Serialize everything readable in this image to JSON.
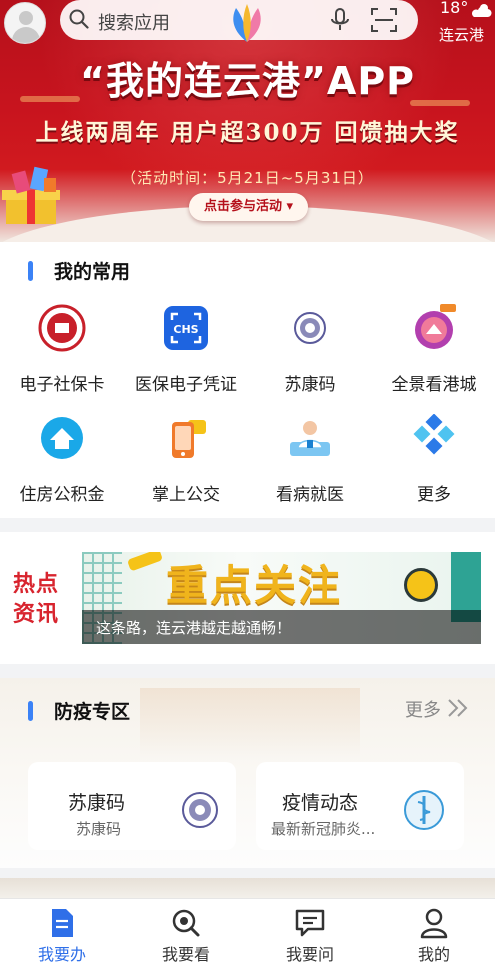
{
  "status": {
    "temperature": "18°",
    "city": "连云港",
    "weather_icon": "cloud-sun-icon"
  },
  "header": {
    "search_placeholder": "搜索应用",
    "mic_icon": "mic-icon",
    "scan_icon": "scan-icon"
  },
  "banner": {
    "title": "“我的连云港”APP",
    "subtitle": "上线两周年 用户超300万 回馈抽大奖",
    "time": "（活动时间：5月21日~5月31日）",
    "button": "点击参与活动"
  },
  "favorites": {
    "title": "我的常用",
    "items": [
      {
        "label": "电子社保卡",
        "icon": "social-security-card-icon"
      },
      {
        "label": "医保电子凭证",
        "icon": "chs-medical-insurance-icon"
      },
      {
        "label": "苏康码",
        "icon": "sukang-code-icon"
      },
      {
        "label": "全景看港城",
        "icon": "panorama-city-icon"
      },
      {
        "label": "住房公积金",
        "icon": "housing-fund-icon"
      },
      {
        "label": "掌上公交",
        "icon": "bus-icon"
      },
      {
        "label": "看病就医",
        "icon": "doctor-icon"
      },
      {
        "label": "更多",
        "icon": "more-grid-icon"
      }
    ]
  },
  "news": {
    "tag": "热点资讯",
    "headline_image_text": "重点关注",
    "caption": "这条路，连云港越走越通畅！"
  },
  "epidemic": {
    "title": "防疫专区",
    "more": "更多",
    "cards": [
      {
        "title": "苏康码",
        "subtitle": "苏康码",
        "icon": "sukang-code-icon"
      },
      {
        "title": "疫情动态",
        "subtitle": "最新新冠肺炎...",
        "icon": "health-emblem-icon"
      }
    ]
  },
  "nav": {
    "tabs": [
      {
        "label": "我要办",
        "icon": "document-icon",
        "active": true
      },
      {
        "label": "我要看",
        "icon": "search-icon",
        "active": false
      },
      {
        "label": "我要问",
        "icon": "chat-icon",
        "active": false
      },
      {
        "label": "我的",
        "icon": "user-icon",
        "active": false
      }
    ]
  },
  "colors": {
    "accent": "#2f6fe8",
    "banner_red": "#c8141e",
    "tag_red": "#d8242e"
  }
}
